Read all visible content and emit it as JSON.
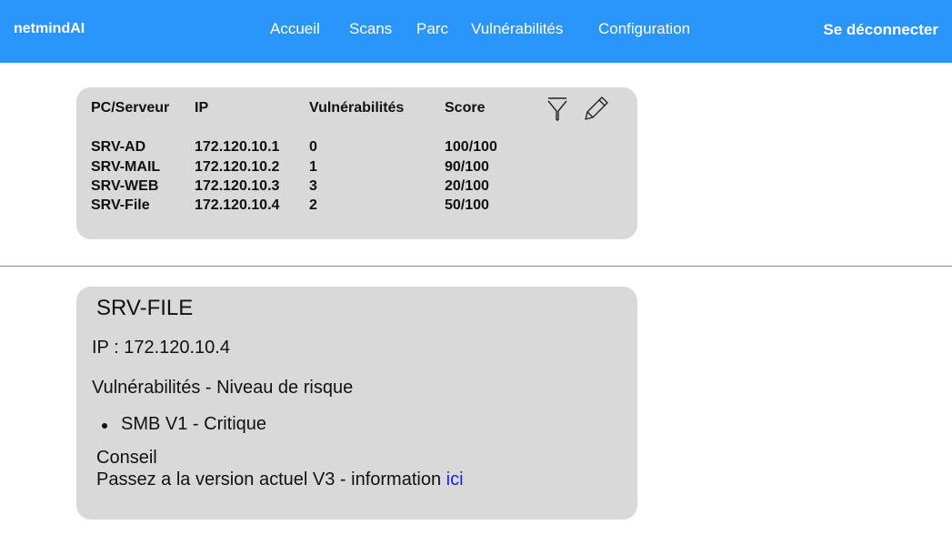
{
  "header": {
    "brand": "netmindAI",
    "nav": [
      "Accueil",
      "Scans",
      "Parc",
      "Vulnérabilités",
      "Configuration"
    ],
    "logout": "Se déconnecter",
    "background_color": "#2a95fb"
  },
  "table": {
    "columns": [
      "PC/Serveur",
      "IP",
      "Vulnérabilités",
      "Score"
    ],
    "rows": [
      [
        "SRV-AD",
        "172.120.10.1",
        "0",
        "100/100"
      ],
      [
        "SRV-MAIL",
        "172.120.10.2",
        "1",
        "90/100"
      ],
      [
        "SRV-WEB",
        "172.120.10.3",
        "3",
        "20/100"
      ],
      [
        "SRV-File",
        "172.120.10.4",
        "2",
        "50/100"
      ]
    ],
    "tools": [
      "filter-icon",
      "edit-pencil-icon"
    ]
  },
  "detail": {
    "title": "SRV-FILE",
    "ip_line": "IP : 172.120.10.4",
    "section_heading": "Vulnérabilités - Niveau de risque",
    "vulnerabilities": [
      "SMB V1 - Critique"
    ],
    "advice_heading": "Conseil",
    "advice_text": "Passez a la version actuel V3 - information ",
    "advice_link": "ici",
    "link_color": "#1a22e0"
  }
}
